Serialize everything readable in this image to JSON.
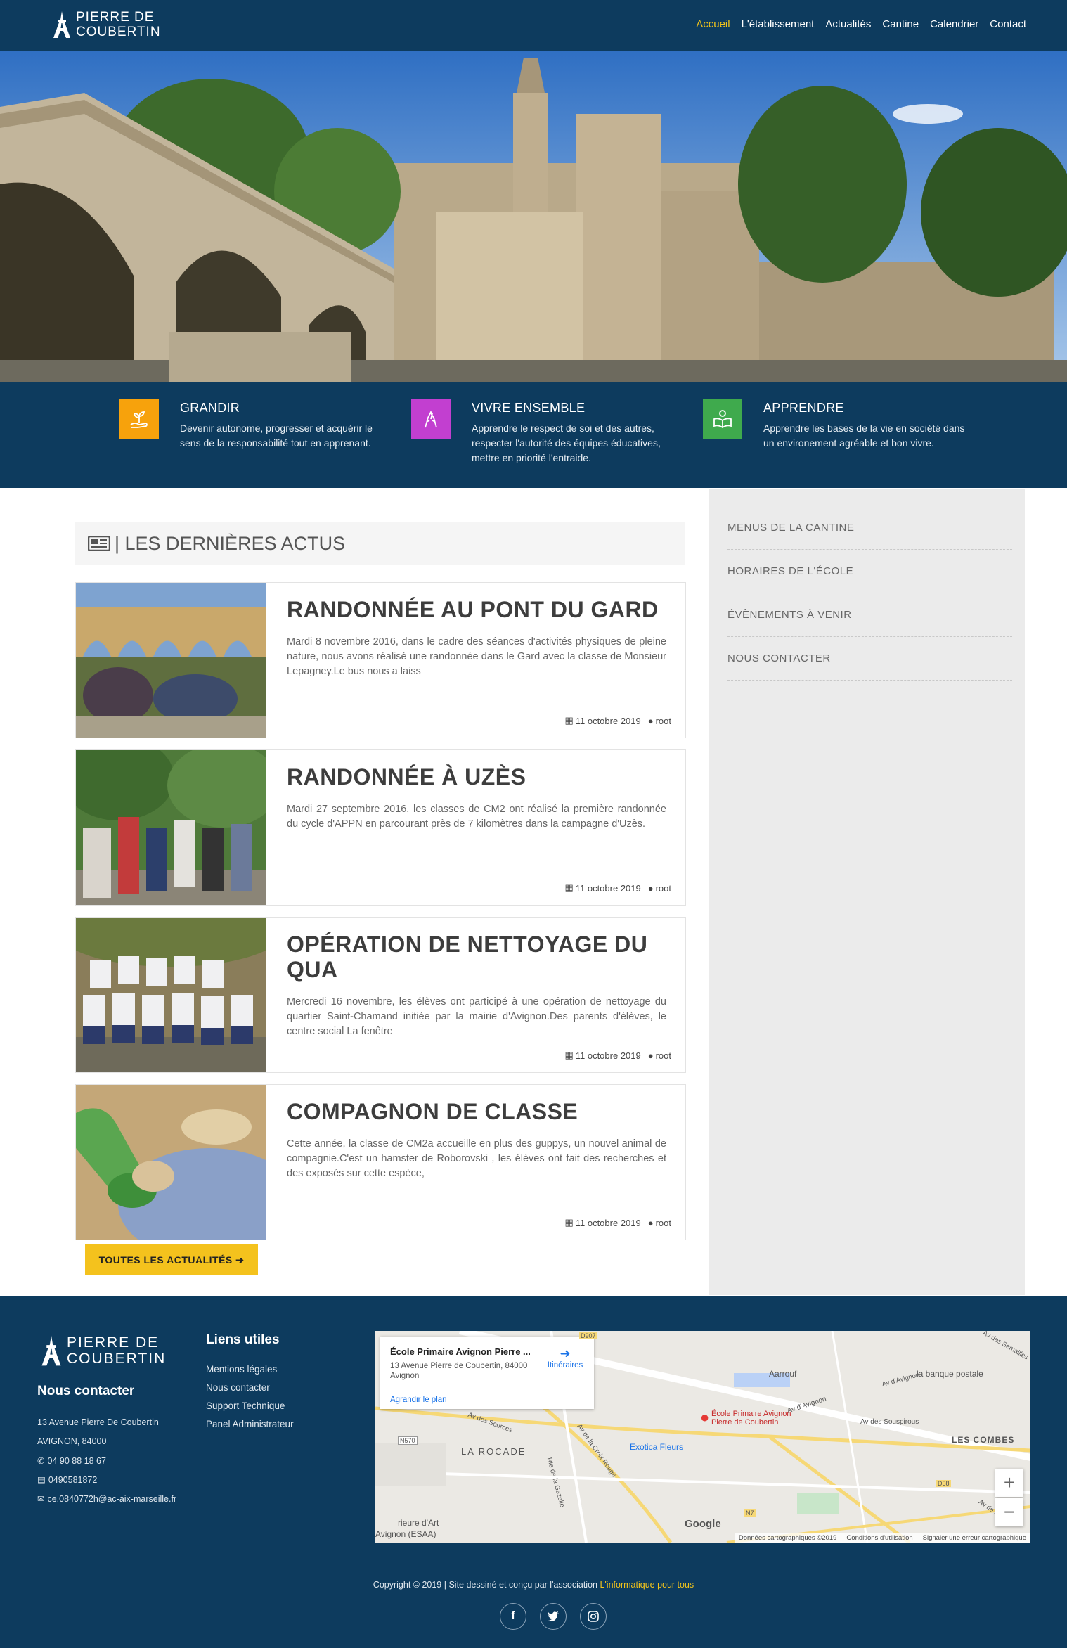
{
  "header": {
    "logo_line1": "PIERRE DE",
    "logo_line2": "COUBERTIN",
    "nav": [
      "Accueil",
      "L'établissement",
      "Actualités",
      "Cantine",
      "Calendrier",
      "Contact"
    ]
  },
  "features": [
    {
      "title": "GRANDIR",
      "text": "Devenir autonome, progresser et acquérir le sens de la responsabilité tout en apprenant.",
      "color": "#f7a20c",
      "icon": "growing-plant-hand-icon"
    },
    {
      "title": "VIVRE ENSEMBLE",
      "text": "Apprendre le respect de soi et des autres, respecter l'autorité des équipes éducatives, mettre en priorité l'entraide.",
      "color": "#c23fd0",
      "icon": "hands-together-icon"
    },
    {
      "title": "APPRENDRE",
      "text": "Apprendre les bases de la vie en société dans un environement agréable et bon vivre.",
      "color": "#3faa4d",
      "icon": "reader-book-icon"
    }
  ],
  "news_section": {
    "title": "| LES DERNIÈRES ACTUS",
    "button": "TOUTES LES ACTUALITÉS ➔"
  },
  "articles": [
    {
      "title": "RANDONNÉE AU PONT DU GARD",
      "excerpt": "Mardi 8 novembre 2016, dans le cadre des séances d'activités physiques de pleine nature, nous avons réalisé une randonnée dans le Gard avec la classe de Monsieur Lepagney.Le bus nous a laiss",
      "date": "11 octobre 2019",
      "author": "root"
    },
    {
      "title": "RANDONNÉE À UZÈS",
      "excerpt": "Mardi 27 septembre 2016, les classes de CM2 ont réalisé la première randonnée du cycle d'APPN en parcourant près de 7 kilomètres dans la campagne d'Uzès.",
      "date": "11 octobre 2019",
      "author": "root"
    },
    {
      "title": "OPÉRATION DE NETTOYAGE DU QUA",
      "excerpt": "Mercredi 16 novembre, les élèves ont participé à une opération de nettoyage du quartier Saint-Chamand initiée par la mairie d'Avignon.Des parents d'élèves, le centre social La fenêtre",
      "date": "11 octobre 2019",
      "author": "root"
    },
    {
      "title": "COMPAGNON DE CLASSE",
      "excerpt": "Cette année, la classe de CM2a accueille en plus des guppys, un nouvel animal de compagnie.C'est un hamster de Roborovski , les élèves ont fait des recherches et des exposés sur cette espèce,",
      "date": "11 octobre 2019",
      "author": "root"
    }
  ],
  "sidebar": [
    "MENUS DE LA CANTINE",
    "HORAIRES DE L'ÉCOLE",
    "ÉVÈNEMENTS À VENIR",
    "NOUS CONTACTER"
  ],
  "footer": {
    "logo_line1": "PIERRE DE",
    "logo_line2": "COUBERTIN",
    "contact_title": "Nous contacter",
    "address1": "13 Avenue Pierre De Coubertin",
    "address2": "AVIGNON, 84000",
    "phone": "04 90 88 18 67",
    "fax": "0490581872",
    "email": "ce.0840772h@ac-aix-marseille.fr",
    "links_title": "Liens utiles",
    "links": [
      "Mentions légales",
      "Nous contacter",
      "Support Technique",
      "Panel Administrateur"
    ],
    "copyright_prefix": "Copyright © 2019 | Site dessiné et conçu par l'association ",
    "copyright_link": "L'informatique pour tous"
  },
  "map": {
    "place_name": "École Primaire Avignon Pierre ...",
    "place_address": "13 Avenue Pierre de Coubertin, 84000 Avignon",
    "directions": "Itinéraires",
    "larger_map": "Agrandir le plan",
    "marker_label_1": "École Primaire Avignon",
    "marker_label_2": "Pierre de Coubertin",
    "labels": [
      "Aarrouf",
      "la banque postale",
      "Av d'Avignon",
      "Av des Souspirous",
      "LES COMBES",
      "Exotica Fleurs",
      "LA ROCADE",
      "Av des Sources",
      "Av de la Croix Rouge",
      "Rte de la Gazelle",
      "rieure d'Art",
      "Avignon (ESAA)",
      "Av d'Avignon",
      "Av de la Pi",
      "Av des Semailles"
    ],
    "roads": [
      "N570",
      "D58",
      "N7",
      "D907"
    ],
    "google": "Google",
    "attribution": [
      "Données cartographiques ©2019",
      "Conditions d'utilisation",
      "Signaler une erreur cartographique"
    ],
    "zoom_in": "+",
    "zoom_out": "−"
  }
}
